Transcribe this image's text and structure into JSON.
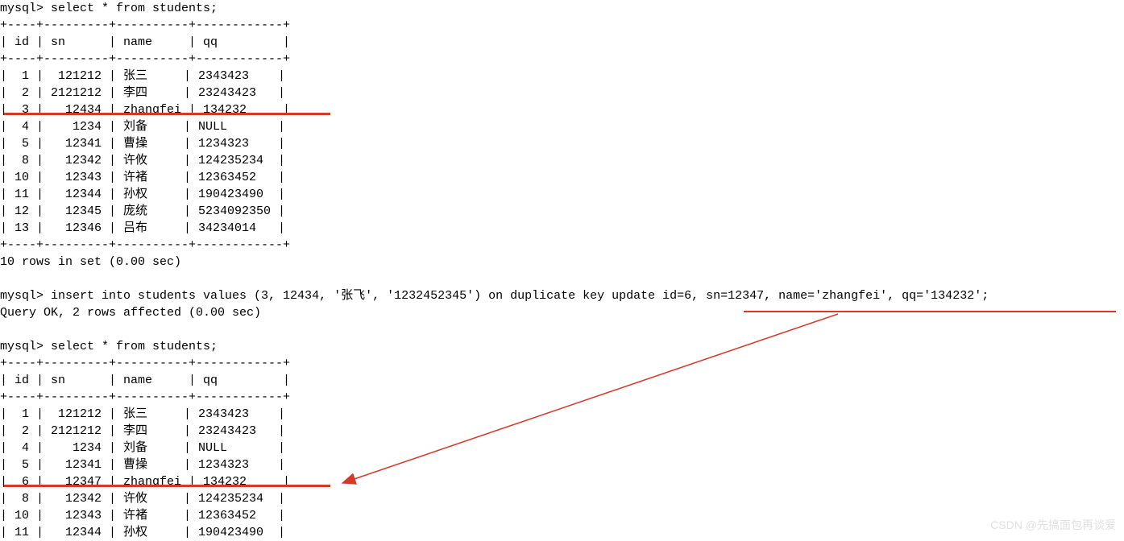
{
  "prompt": "mysql>",
  "query_select": "select * from students;",
  "query_insert": "insert into students values (3, 12434, '张飞', '1232452345') on duplicate key update id=6, sn=12347, name='zhangfei', qq='134232';",
  "result_affected": "Query OK, 2 rows affected (0.00 sec)",
  "result_set_count": "10 rows in set (0.00 sec)",
  "table_border": "+----+---------+----------+------------+",
  "cols": {
    "id": "id",
    "sn": "sn",
    "name": "name",
    "qq": "qq"
  },
  "table1": {
    "rows": [
      {
        "id": "1",
        "sn": "121212",
        "name": "张三",
        "qq": "2343423"
      },
      {
        "id": "2",
        "sn": "2121212",
        "name": "李四",
        "qq": "23243423"
      },
      {
        "id": "3",
        "sn": "12434",
        "name": "zhangfei",
        "qq": "134232"
      },
      {
        "id": "4",
        "sn": "1234",
        "name": "刘备",
        "qq": "NULL"
      },
      {
        "id": "5",
        "sn": "12341",
        "name": "曹操",
        "qq": "1234323"
      },
      {
        "id": "8",
        "sn": "12342",
        "name": "许攸",
        "qq": "124235234"
      },
      {
        "id": "10",
        "sn": "12343",
        "name": "许褚",
        "qq": "12363452"
      },
      {
        "id": "11",
        "sn": "12344",
        "name": "孙权",
        "qq": "190423490"
      },
      {
        "id": "12",
        "sn": "12345",
        "name": "庞统",
        "qq": "5234092350"
      },
      {
        "id": "13",
        "sn": "12346",
        "name": "吕布",
        "qq": "34234014"
      }
    ]
  },
  "table2": {
    "rows": [
      {
        "id": "1",
        "sn": "121212",
        "name": "张三",
        "qq": "2343423"
      },
      {
        "id": "2",
        "sn": "2121212",
        "name": "李四",
        "qq": "23243423"
      },
      {
        "id": "4",
        "sn": "1234",
        "name": "刘备",
        "qq": "NULL"
      },
      {
        "id": "5",
        "sn": "12341",
        "name": "曹操",
        "qq": "1234323"
      },
      {
        "id": "6",
        "sn": "12347",
        "name": "zhangfei",
        "qq": "134232"
      },
      {
        "id": "8",
        "sn": "12342",
        "name": "许攸",
        "qq": "124235234"
      },
      {
        "id": "10",
        "sn": "12343",
        "name": "许褚",
        "qq": "12363452"
      },
      {
        "id": "11",
        "sn": "12344",
        "name": "孙权",
        "qq": "190423490"
      }
    ]
  },
  "watermark": "CSDN @先搞面包再谈爱"
}
